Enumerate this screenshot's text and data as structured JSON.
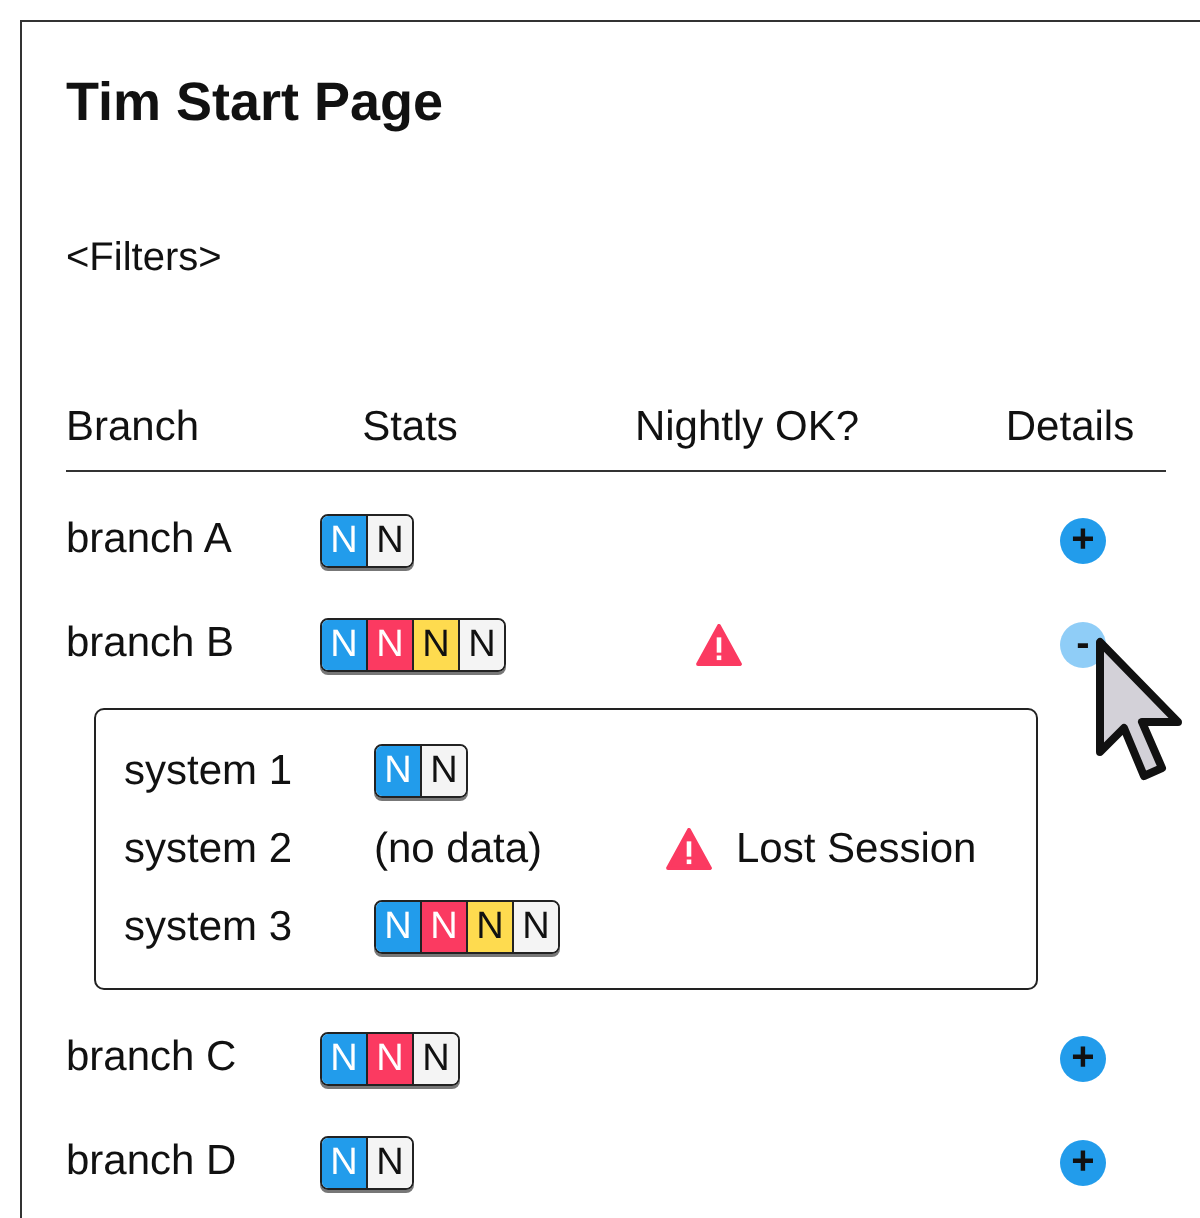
{
  "title": "Tim Start Page",
  "filters": "<Filters>",
  "columns": [
    "Branch",
    "Stats",
    "Nightly OK?",
    "Details"
  ],
  "branches": [
    {
      "name": "branch A",
      "stats": [
        {
          "label": "N",
          "color": "#229ceb"
        },
        {
          "label": "N",
          "color": "#f4f4f4"
        }
      ],
      "warning": false,
      "toggle": "+",
      "expanded": false
    },
    {
      "name": "branch B",
      "stats": [
        {
          "label": "N",
          "color": "#229ceb"
        },
        {
          "label": "N",
          "color": "#fb3a61"
        },
        {
          "label": "N",
          "color": "#fedb4f"
        },
        {
          "label": "N",
          "color": "#f4f4f4"
        }
      ],
      "warning": true,
      "toggle": "-",
      "expanded": true,
      "systems": [
        {
          "name": "system 1",
          "stats": [
            {
              "label": "N",
              "color": "#229ceb"
            },
            {
              "label": "N",
              "color": "#f4f4f4"
            }
          ]
        },
        {
          "name": "system 2",
          "note": "(no data)",
          "issue": "Lost Session"
        },
        {
          "name": "system 3",
          "stats": [
            {
              "label": "N",
              "color": "#229ceb"
            },
            {
              "label": "N",
              "color": "#fb3a61"
            },
            {
              "label": "N",
              "color": "#fedb4f"
            },
            {
              "label": "N",
              "color": "#f4f4f4"
            }
          ]
        }
      ]
    },
    {
      "name": "branch C",
      "stats": [
        {
          "label": "N",
          "color": "#229ceb"
        },
        {
          "label": "N",
          "color": "#fb3a61"
        },
        {
          "label": "N",
          "color": "#f4f4f4"
        }
      ],
      "warning": false,
      "toggle": "+",
      "expanded": false
    },
    {
      "name": "branch D",
      "stats": [
        {
          "label": "N",
          "color": "#229ceb"
        },
        {
          "label": "N",
          "color": "#f4f4f4"
        }
      ],
      "warning": false,
      "toggle": "+",
      "expanded": false
    }
  ]
}
